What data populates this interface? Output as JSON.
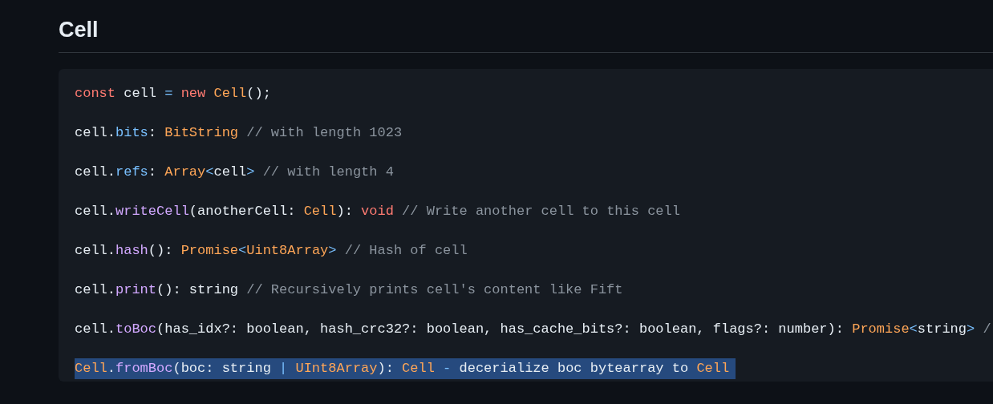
{
  "heading": "Cell",
  "code_lines": [
    {
      "selected": false,
      "tokens": [
        {
          "kind": "keyword",
          "text": "const"
        },
        {
          "kind": "plain",
          "text": " cell "
        },
        {
          "kind": "operator",
          "text": "="
        },
        {
          "kind": "keyword",
          "text": " new"
        },
        {
          "kind": "type",
          "text": " Cell"
        },
        {
          "kind": "plain",
          "text": "();"
        }
      ]
    },
    {
      "selected": false,
      "tokens": [
        {
          "kind": "plain",
          "text": "cell."
        },
        {
          "kind": "property",
          "text": "bits"
        },
        {
          "kind": "plain",
          "text": ": "
        },
        {
          "kind": "type",
          "text": "BitString"
        },
        {
          "kind": "comment",
          "text": " // with length 1023"
        }
      ]
    },
    {
      "selected": false,
      "tokens": [
        {
          "kind": "plain",
          "text": "cell."
        },
        {
          "kind": "property",
          "text": "refs"
        },
        {
          "kind": "plain",
          "text": ": "
        },
        {
          "kind": "type",
          "text": "Array"
        },
        {
          "kind": "operator",
          "text": "<"
        },
        {
          "kind": "plain",
          "text": "cell"
        },
        {
          "kind": "operator",
          "text": ">"
        },
        {
          "kind": "comment",
          "text": " // with length 4"
        }
      ]
    },
    {
      "selected": false,
      "tokens": [
        {
          "kind": "plain",
          "text": "cell."
        },
        {
          "kind": "function",
          "text": "writeCell"
        },
        {
          "kind": "plain",
          "text": "(anotherCell: "
        },
        {
          "kind": "type",
          "text": "Cell"
        },
        {
          "kind": "plain",
          "text": "): "
        },
        {
          "kind": "keyword",
          "text": "void"
        },
        {
          "kind": "comment",
          "text": " // Write another cell to this cell"
        }
      ]
    },
    {
      "selected": false,
      "tokens": [
        {
          "kind": "plain",
          "text": "cell."
        },
        {
          "kind": "function",
          "text": "hash"
        },
        {
          "kind": "plain",
          "text": "(): "
        },
        {
          "kind": "type",
          "text": "Promise"
        },
        {
          "kind": "operator",
          "text": "<"
        },
        {
          "kind": "type",
          "text": "Uint8Array"
        },
        {
          "kind": "operator",
          "text": ">"
        },
        {
          "kind": "comment",
          "text": " // Hash of cell"
        }
      ]
    },
    {
      "selected": false,
      "tokens": [
        {
          "kind": "plain",
          "text": "cell."
        },
        {
          "kind": "function",
          "text": "print"
        },
        {
          "kind": "plain",
          "text": "(): string "
        },
        {
          "kind": "comment",
          "text": "// Recursively prints cell's content like Fift"
        }
      ]
    },
    {
      "selected": false,
      "tokens": [
        {
          "kind": "plain",
          "text": "cell."
        },
        {
          "kind": "function",
          "text": "toBoc"
        },
        {
          "kind": "plain",
          "text": "(has_idx?: boolean, hash_crc32?: boolean, has_cache_bits?: boolean, flags?: number): "
        },
        {
          "kind": "type",
          "text": "Promise"
        },
        {
          "kind": "operator",
          "text": "<"
        },
        {
          "kind": "plain",
          "text": "string"
        },
        {
          "kind": "operator",
          "text": ">"
        },
        {
          "kind": "comment",
          "text": " /"
        }
      ]
    },
    {
      "selected": true,
      "tokens": [
        {
          "kind": "type",
          "text": "Cell"
        },
        {
          "kind": "plain",
          "text": "."
        },
        {
          "kind": "function",
          "text": "fromBoc"
        },
        {
          "kind": "plain",
          "text": "(boc: string "
        },
        {
          "kind": "operator",
          "text": "|"
        },
        {
          "kind": "type",
          "text": " UInt8Array"
        },
        {
          "kind": "plain",
          "text": "): "
        },
        {
          "kind": "type",
          "text": "Cell"
        },
        {
          "kind": "operator",
          "text": " -"
        },
        {
          "kind": "plain",
          "text": " decerialize boc bytearray to "
        },
        {
          "kind": "type",
          "text": "Cell"
        }
      ]
    }
  ]
}
